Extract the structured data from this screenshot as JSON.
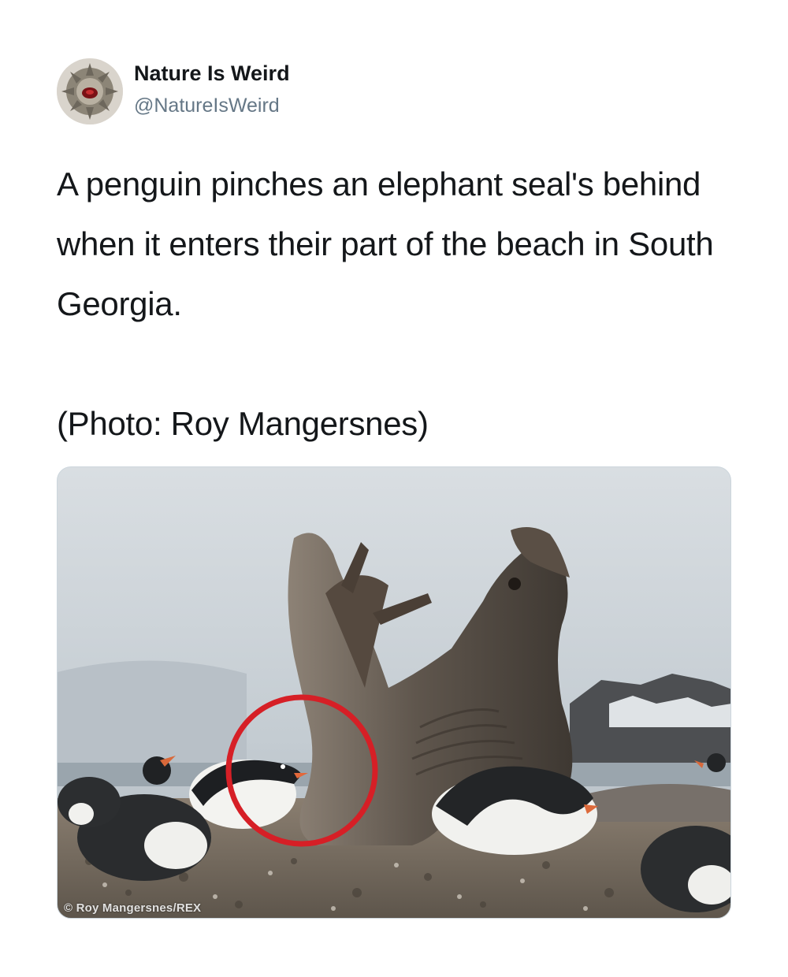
{
  "tweet": {
    "author": {
      "display_name": "Nature Is Weird",
      "handle": "@NatureIsWeird",
      "avatar_icon": "avatar-image"
    },
    "text_paragraphs": [
      "A penguin pinches an elephant seal's behind when it enters their part of the beach in South Georgia.",
      "(Photo: Roy Mangersnes)"
    ],
    "media": {
      "watermark": "© Roy Mangersnes/REX",
      "highlight_color": "#d61f26"
    }
  }
}
